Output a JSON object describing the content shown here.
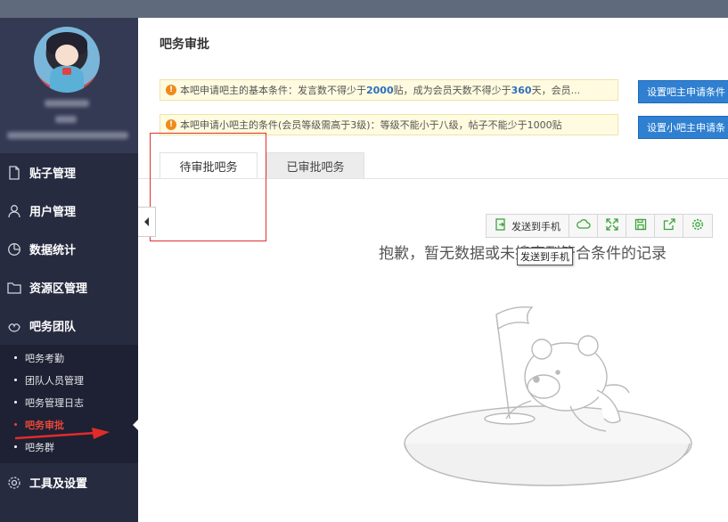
{
  "sidebar": {
    "menu": [
      {
        "label": "贴子管理",
        "icon": "document-icon"
      },
      {
        "label": "用户管理",
        "icon": "user-icon"
      },
      {
        "label": "数据统计",
        "icon": "pie-chart-icon"
      },
      {
        "label": "资源区管理",
        "icon": "folder-icon"
      },
      {
        "label": "吧务团队",
        "icon": "team-icon"
      }
    ],
    "team_submenu": [
      {
        "label": "吧务考勤"
      },
      {
        "label": "团队人员管理"
      },
      {
        "label": "吧务管理日志"
      },
      {
        "label": "吧务审批",
        "active": true
      },
      {
        "label": "吧务群"
      }
    ],
    "settings": {
      "label": "工具及设置",
      "icon": "gear-icon"
    }
  },
  "main": {
    "title": "吧务审批",
    "notice1": {
      "prefix": "本吧申请吧主的基本条件：发言数不得少于 ",
      "posts": "2000",
      "mid": " 贴，成为会员天数不得少于",
      "days": "360",
      "suffix": "天，会员..."
    },
    "notice2": "本吧申请小吧主的条件(会员等级需高于3级)：等级不能小于八级，帖子不能少于1000贴",
    "button1": "设置吧主申请条件",
    "button2": "设置小吧主申请条",
    "tabs": [
      {
        "label": "待审批吧务",
        "active": true
      },
      {
        "label": "已审批吧务"
      }
    ],
    "toolbar": {
      "send_label": "发送到手机",
      "tools": [
        "cloud-icon",
        "expand-icon",
        "save-icon",
        "share-icon",
        "gear-icon"
      ]
    },
    "tooltip": "发送到手机",
    "empty_message": "抱歉，暂无数据或未搜索到符合条件的记录"
  },
  "colors": {
    "sidebar_bg": "#272b40",
    "active_red": "#e8463a",
    "button_blue": "#2f80d1",
    "link_blue": "#2c6fbf",
    "toolbar_green": "#3aa63a"
  }
}
